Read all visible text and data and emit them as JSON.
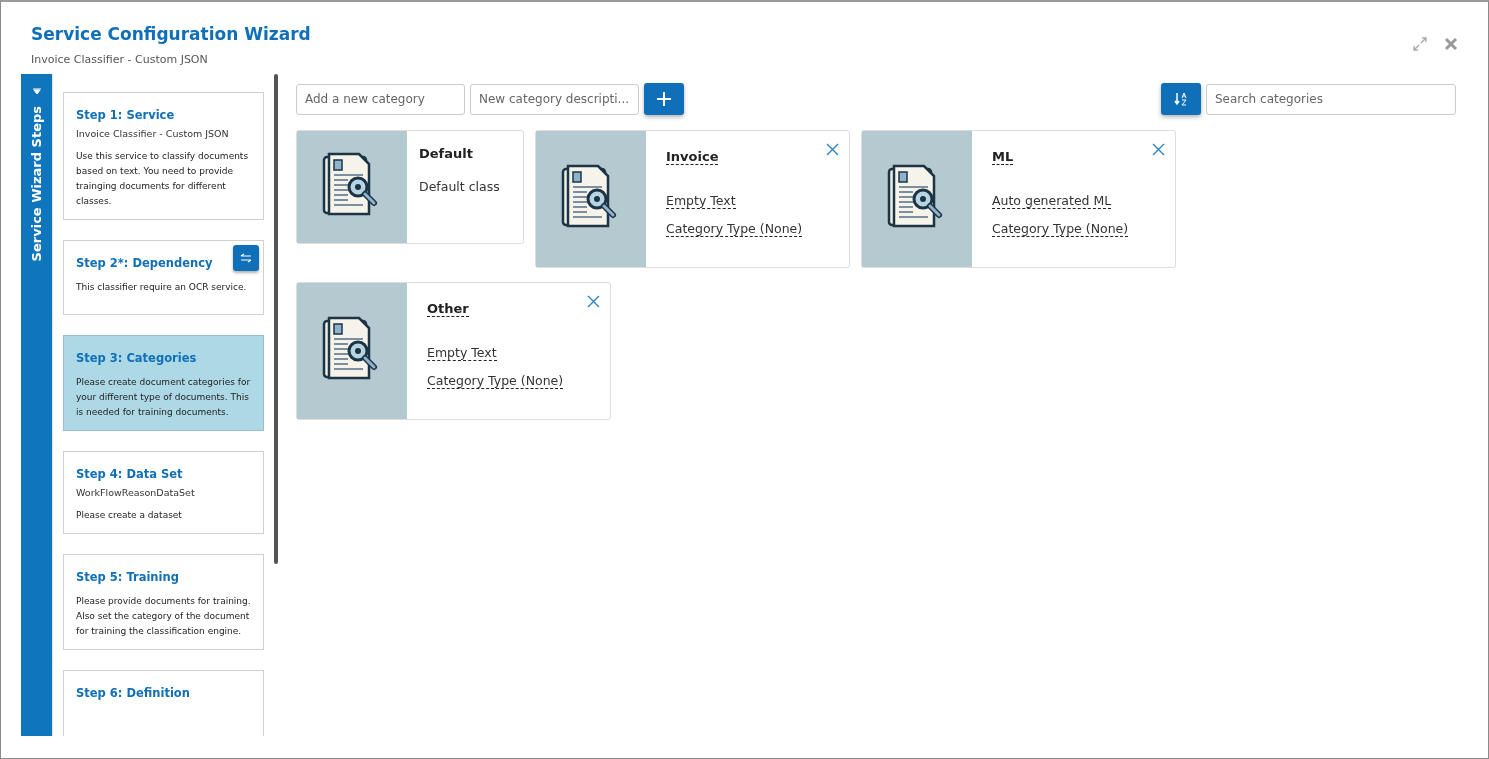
{
  "dialog": {
    "title": "Service Configuration Wizard",
    "subtitle": "Invoice Classifier - Custom JSON"
  },
  "sidebar": {
    "title": "Service Wizard Steps",
    "steps": [
      {
        "title": "Step 1: Service",
        "subtitle": "Invoice Classifier - Custom JSON",
        "description": "Use this service to classify documents based on text. You need to provide trainging documents for different classes.",
        "selected": false,
        "has_action": false
      },
      {
        "title": "Step 2*: Dependency",
        "description": "This classifier require an OCR service.",
        "selected": false,
        "has_action": true
      },
      {
        "title": "Step 3: Categories",
        "description": "Please create document categories for your different type of documents. This is needed for training documents.",
        "selected": true,
        "has_action": false
      },
      {
        "title": "Step 4: Data Set",
        "subtitle": "WorkFlowReasonDataSet",
        "description": "Please create a dataset",
        "selected": false,
        "has_action": false
      },
      {
        "title": "Step 5: Training",
        "description": "Please provide documents for training. Also set the category of the document for training the classification engine.",
        "selected": false,
        "has_action": false
      },
      {
        "title": "Step 6: Definition",
        "selected": false,
        "has_action": false
      }
    ]
  },
  "toolbar": {
    "name_placeholder": "Add a new category",
    "description_placeholder": "New category descripti...",
    "search_placeholder": "Search categories"
  },
  "categories": [
    {
      "kind": "default",
      "name": "Default",
      "description": "Default class"
    },
    {
      "kind": "editable",
      "name": "Invoice",
      "description": "Empty Text",
      "type": "Category Type (None)"
    },
    {
      "kind": "editable",
      "name": "ML",
      "description": "Auto generated ML",
      "type": "Category Type (None)"
    },
    {
      "kind": "editable",
      "name": "Other",
      "description": "Empty Text",
      "type": "Category Type (None)"
    }
  ]
}
